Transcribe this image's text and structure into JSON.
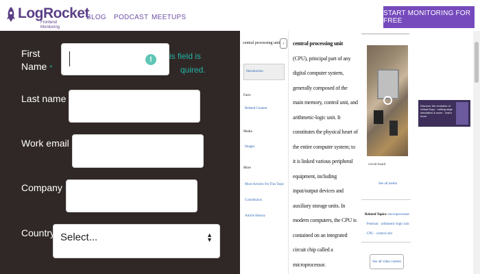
{
  "header": {
    "logo_text": "LogRocket",
    "logo_subtitle": "Frontend Monitoring",
    "nav": [
      "BLOG",
      "PODCAST",
      "MEETUPS"
    ],
    "cta_label": "START MONITORING FOR FREE",
    "brand_color": "#764abc"
  },
  "form": {
    "fields": [
      {
        "label": "First Name",
        "required_mark": "*",
        "value": ""
      },
      {
        "label": "Last name",
        "required_mark": "*",
        "value": ""
      },
      {
        "label": "Work email",
        "required_mark": "*",
        "value": ""
      },
      {
        "label": "Company",
        "required_mark": "*",
        "value": ""
      },
      {
        "label": "Country",
        "required_mark": "*",
        "value": "Select..."
      }
    ],
    "error_text": "This field is required.",
    "error_visible_text": "is field is\nquired.",
    "warning_icon": "!",
    "panel_color": "#302826",
    "accent_color": "#22b3a6"
  },
  "article": {
    "toc_title": "central processing unit",
    "toc_toggle": "‹",
    "toc_intro": "Introduction",
    "facts_heading": "Facts",
    "facts_link": "Related Content",
    "media_heading": "Media",
    "media_link": "Images",
    "more_heading": "More",
    "more_links": [
      "More Articles On This Topic",
      "Contributors",
      "Article History"
    ],
    "body_lead": "central processing unit",
    "body_text": "(CPU), principal part of any digital computer system, generally composed of the main memory, control unit, and arithmetic-logic unit. It constitutes the physical heart of the entire computer system; to it is linked various peripheral equipment, including input/output devices and auxiliary storage units. In modern computers, the CPU is contained on an integrated circuit chip called a microprocessor.",
    "image_caption": "circuit board",
    "see_all_media": "See all media",
    "related_label": "Related Topics:",
    "related_topics": "microprocessor · Pentium · arithmetic-logic unit · CPU · control unit",
    "see_video": "See all video content"
  },
  "ad": {
    "text": "Discover the evolution of Virtual Expo · cutting edge simulation & more · Learn more"
  }
}
